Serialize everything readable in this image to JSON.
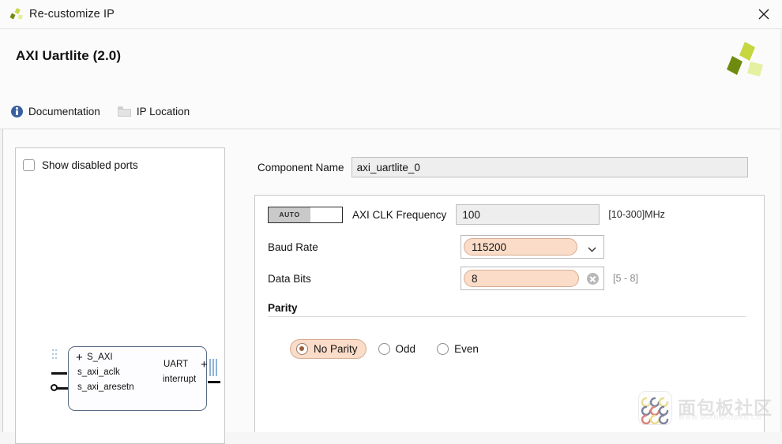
{
  "window": {
    "title": "Re-customize IP",
    "app_icon": "xilinx-logo-icon",
    "close_icon": "close-icon"
  },
  "header": {
    "title": "AXI Uartlite (2.0)",
    "brand_logo": "xilinx-logo-icon"
  },
  "links": [
    {
      "label": "Documentation",
      "icon": "info-icon"
    },
    {
      "label": "IP Location",
      "icon": "folder-icon"
    }
  ],
  "preview": {
    "show_disabled_ports": {
      "label": "Show disabled ports",
      "checked": false
    },
    "block": {
      "left_ports": [
        "S_AXI",
        "s_axi_aclk",
        "s_axi_aresetn"
      ],
      "right_ports": [
        "UART",
        "interrupt"
      ],
      "plus_left": "+",
      "plus_right": "+"
    }
  },
  "settings": {
    "component_name": {
      "label": "Component Name",
      "value": "axi_uartlite_0"
    },
    "clk": {
      "auto_label": "AUTO",
      "label": "AXI CLK Frequency",
      "value": "100",
      "hint": "[10-300]MHz"
    },
    "baud": {
      "label": "Baud Rate",
      "value": "115200",
      "dropdown_icon": "chevron-down-icon"
    },
    "data_bits": {
      "label": "Data Bits",
      "value": "8",
      "clear_icon": "clear-circle-icon",
      "hint": "[5 - 8]"
    },
    "parity": {
      "section_title": "Parity",
      "options": [
        {
          "label": "No Parity",
          "selected": true
        },
        {
          "label": "Odd",
          "selected": false
        },
        {
          "label": "Even",
          "selected": false
        }
      ]
    }
  },
  "watermark": {
    "text": "面包板社区",
    "subtext": "WWW.MIANBAOBAN.CN",
    "logo": "watermark-logo-icon"
  },
  "colors": {
    "accent_peach": "#fadcc8",
    "peach_border": "#d7ad92",
    "radio_dot": "#9b5e3a",
    "info_blue": "#3a5fa0",
    "block_border": "#5a6b86"
  }
}
